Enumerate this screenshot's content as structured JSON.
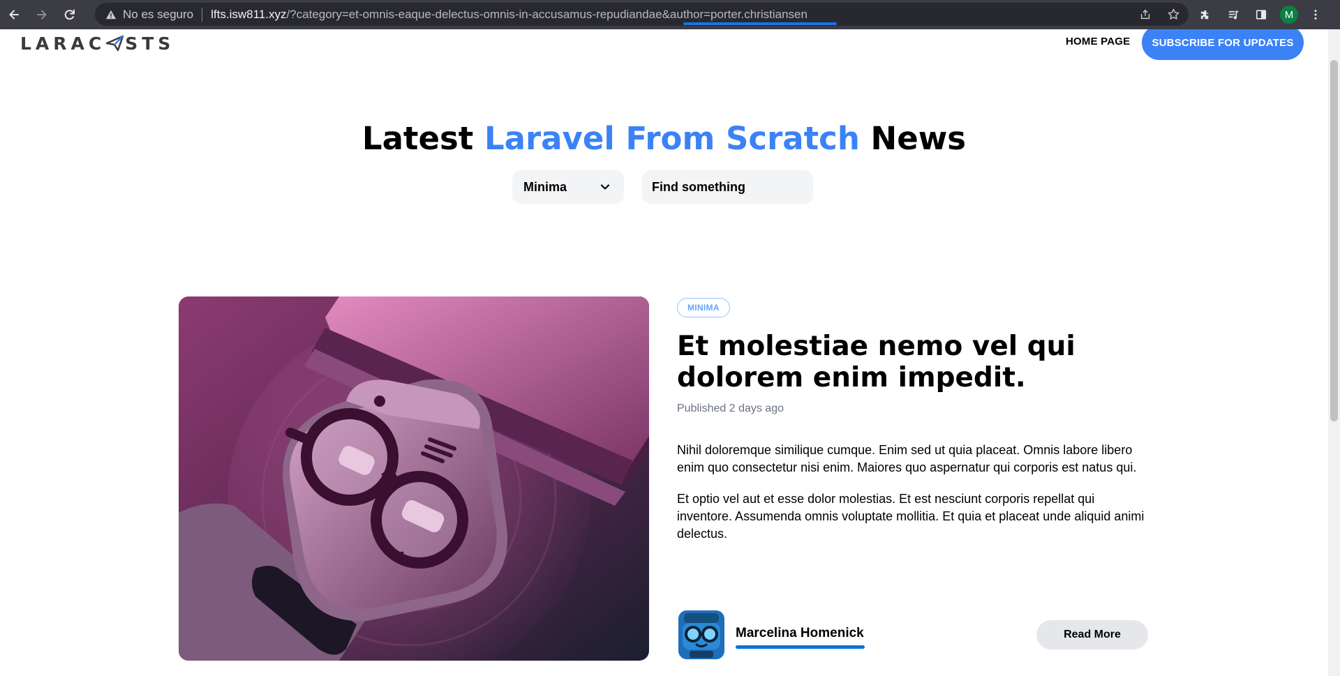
{
  "browser": {
    "security_label": "No es seguro",
    "url_host": "lfts.isw811.xyz",
    "url_rest": "/?category=et-omnis-eaque-delectus-omnis-in-accusamus-repudiandae&author=porter.christiansen",
    "profile_initial": "M",
    "profile_color": "#0b8043",
    "icons": [
      "back-arrow-icon",
      "forward-arrow-icon",
      "reload-icon",
      "warning-icon",
      "share-icon",
      "star-icon",
      "puzzle-icon",
      "media-icon",
      "side-panel-icon",
      "more-vert-icon"
    ]
  },
  "header": {
    "logo_text": "LARAC STS",
    "home_label": "HOME PAGE",
    "subscribe_label": "SUBSCRIBE FOR UPDATES"
  },
  "hero": {
    "title_prefix": "Latest ",
    "title_accent": "Laravel From Scratch",
    "title_suffix": " News",
    "accent_color": "#3b82f6"
  },
  "filters": {
    "category_selected": "Minima",
    "search_placeholder": "Find something"
  },
  "post": {
    "category": "MINIMA",
    "title": "Et molestiae nemo vel qui dolorem enim impedit.",
    "published_label": "Published ",
    "published_time": "2 days ago",
    "paragraphs": [
      "Nihil doloremque similique cumque. Enim sed ut quia placeat. Omnis labore libero enim quo consectetur nisi enim. Maiores quo aspernatur qui corporis est natus qui.",
      "Et optio vel aut et esse dolor molestias. Et est nesciunt corporis repellat qui inventore. Assumenda omnis voluptate mollitia. Et quia et placeat unde aliquid animi delectus."
    ],
    "author_name": "Marcelina Homenick",
    "read_more_label": "Read More"
  }
}
